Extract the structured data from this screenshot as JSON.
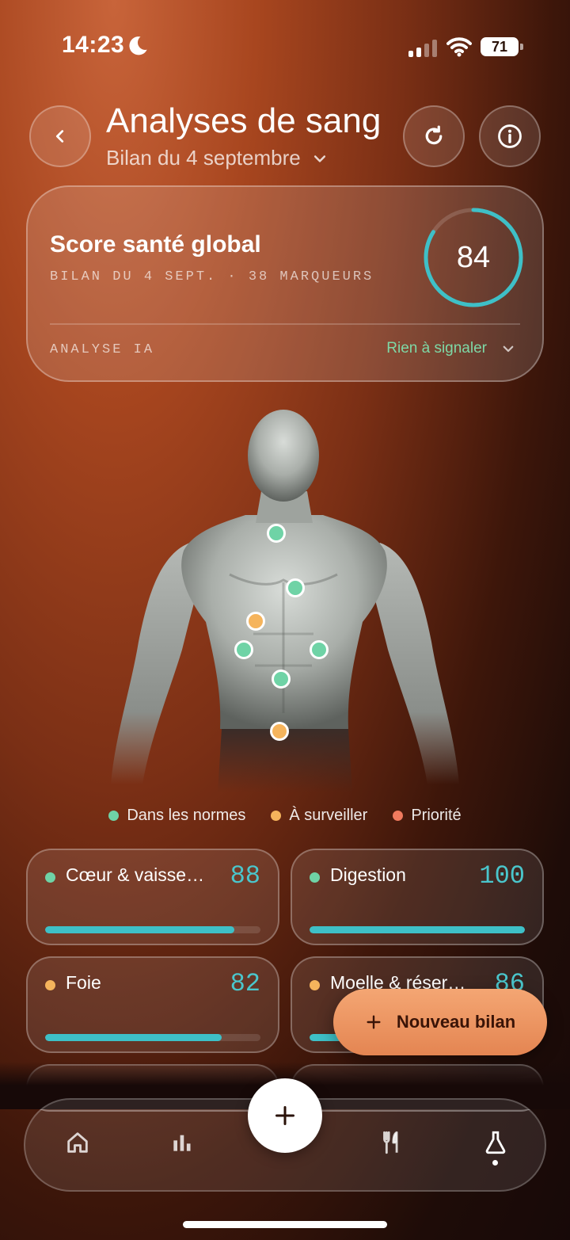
{
  "status_bar": {
    "time": "14:23",
    "battery": "71"
  },
  "header": {
    "title": "Analyses de sang",
    "subtitle": "Bilan du 4 septembre"
  },
  "score_card": {
    "title": "Score santé global",
    "meta": "BILAN DU 4 SEPT. · 38 MARQUEURS",
    "score": "84",
    "score_fraction": 0.84,
    "ai_label": "ANALYSE IA",
    "ai_status": "Rien à signaler"
  },
  "legend": [
    {
      "label": "Dans les normes",
      "color": "#6fd3a6"
    },
    {
      "label": "À surveiller",
      "color": "#f5b45c"
    },
    {
      "label": "Priorité",
      "color": "#f07a5e"
    }
  ],
  "cards": [
    {
      "name": "Cœur & vaisse…",
      "value": "88",
      "progress": 0.88,
      "status_color": "#6fd3a6"
    },
    {
      "name": "Digestion",
      "value": "100",
      "progress": 1.0,
      "status_color": "#6fd3a6"
    },
    {
      "name": "Foie",
      "value": "82",
      "progress": 0.82,
      "status_color": "#f5b45c"
    },
    {
      "name": "Moelle & réser…",
      "value": "86",
      "progress": 0.86,
      "status_color": "#f5b45c"
    }
  ],
  "new_button": {
    "label": "Nouveau bilan"
  },
  "tabs": [
    "home-icon",
    "chart-icon",
    "add-icon",
    "fork-knife-icon",
    "flask-icon"
  ],
  "colors": {
    "accent": "#3ec0c7",
    "cta": "#e48552",
    "normal": "#6fd3a6",
    "watch": "#f5b45c",
    "priority": "#f07a5e"
  }
}
